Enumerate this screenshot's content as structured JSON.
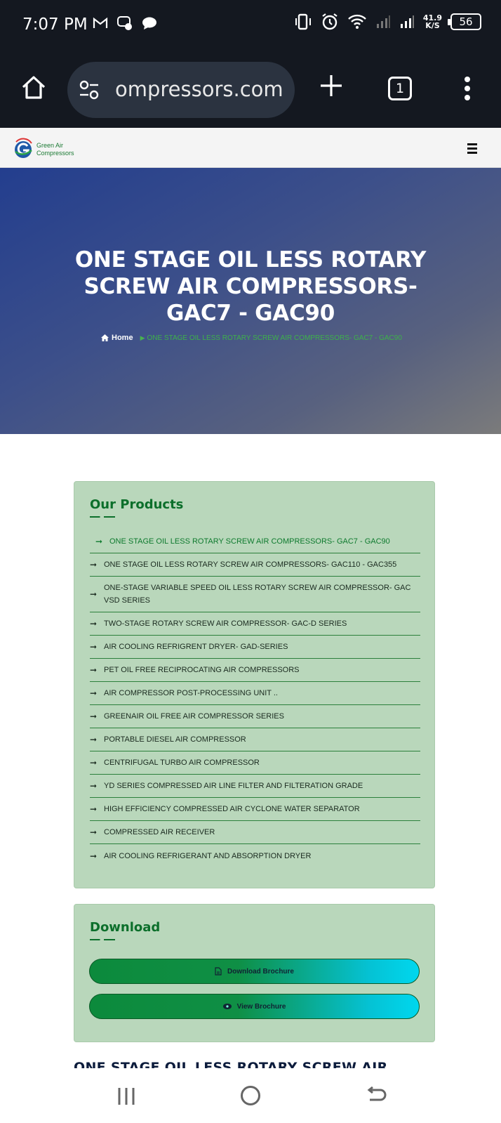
{
  "status_bar": {
    "time": "7:07 PM",
    "speed_value": "41.9",
    "speed_unit": "K/S",
    "battery": "56"
  },
  "browser": {
    "url": "ompressors.com",
    "tab_count": "1"
  },
  "site": {
    "logo_line1": "Green Air",
    "logo_line2": "Compressors"
  },
  "hero": {
    "title": "ONE STAGE OIL LESS ROTARY SCREW AIR COMPRESSORS- GAC7 - GAC90",
    "breadcrumb_home": "Home",
    "breadcrumb_current": "ONE STAGE OIL LESS ROTARY SCREW AIR COMPRESSORS- GAC7 - GAC90"
  },
  "products": {
    "title": "Our Products",
    "items": [
      "ONE STAGE OIL LESS ROTARY SCREW AIR COMPRESSORS- GAC7 - GAC90",
      "ONE STAGE OIL LESS ROTARY SCREW AIR COMPRESSORS- GAC110 - GAC355",
      "ONE-STAGE VARIABLE SPEED OIL LESS ROTARY SCREW AIR COMPRESSOR- GAC VSD SERIES",
      "TWO-STAGE ROTARY SCREW AIR COMPRESSOR- GAC-D SERIES",
      "AIR COOLING REFRIGRENT DRYER- GAD-SERIES",
      "PET OIL FREE RECIPROCATING AIR COMPRESSORS",
      "AIR COMPRESSOR POST-PROCESSING UNIT ..",
      "GREENAIR OIL FREE AIR COMPRESSOR SERIES",
      "PORTABLE DIESEL AIR COMPRESSOR",
      "CENTRIFUGAL TURBO AIR COMPRESSOR",
      "YD SERIES COMPRESSED AIR LINE FILTER AND FILTERATION GRADE",
      "HIGH EFFICIENCY COMPRESSED AIR CYCLONE WATER SEPARATOR",
      "COMPRESSED AIR RECEIVER",
      "AIR COOLING REFRIGERANT AND ABSORPTION DRYER"
    ]
  },
  "download": {
    "title": "Download",
    "download_label": "Download Brochure",
    "view_label": "View Brochure"
  },
  "next_section": {
    "heading": "ONE STAGE OIL LESS ROTARY SCREW AIR"
  },
  "colors": {
    "brand_green": "#0c6f2b",
    "card_bg": "#b9d7bb",
    "button_gradient_start": "#0c8a3c",
    "button_gradient_end": "#00d7ee",
    "hero_blue": "#233e8e"
  }
}
